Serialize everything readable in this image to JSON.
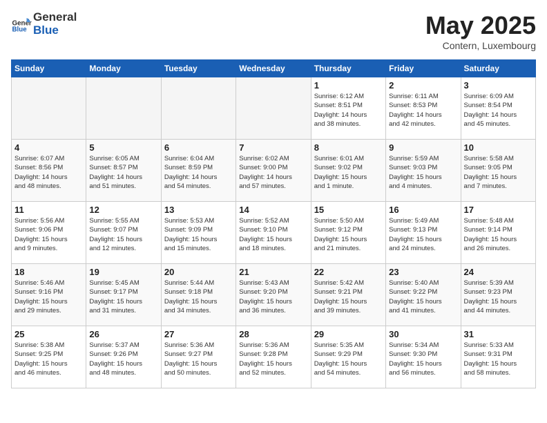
{
  "header": {
    "logo_general": "General",
    "logo_blue": "Blue",
    "month": "May 2025",
    "location": "Contern, Luxembourg"
  },
  "weekdays": [
    "Sunday",
    "Monday",
    "Tuesday",
    "Wednesday",
    "Thursday",
    "Friday",
    "Saturday"
  ],
  "weeks": [
    [
      {
        "day": "",
        "info": ""
      },
      {
        "day": "",
        "info": ""
      },
      {
        "day": "",
        "info": ""
      },
      {
        "day": "",
        "info": ""
      },
      {
        "day": "1",
        "info": "Sunrise: 6:12 AM\nSunset: 8:51 PM\nDaylight: 14 hours\nand 38 minutes."
      },
      {
        "day": "2",
        "info": "Sunrise: 6:11 AM\nSunset: 8:53 PM\nDaylight: 14 hours\nand 42 minutes."
      },
      {
        "day": "3",
        "info": "Sunrise: 6:09 AM\nSunset: 8:54 PM\nDaylight: 14 hours\nand 45 minutes."
      }
    ],
    [
      {
        "day": "4",
        "info": "Sunrise: 6:07 AM\nSunset: 8:56 PM\nDaylight: 14 hours\nand 48 minutes."
      },
      {
        "day": "5",
        "info": "Sunrise: 6:05 AM\nSunset: 8:57 PM\nDaylight: 14 hours\nand 51 minutes."
      },
      {
        "day": "6",
        "info": "Sunrise: 6:04 AM\nSunset: 8:59 PM\nDaylight: 14 hours\nand 54 minutes."
      },
      {
        "day": "7",
        "info": "Sunrise: 6:02 AM\nSunset: 9:00 PM\nDaylight: 14 hours\nand 57 minutes."
      },
      {
        "day": "8",
        "info": "Sunrise: 6:01 AM\nSunset: 9:02 PM\nDaylight: 15 hours\nand 1 minute."
      },
      {
        "day": "9",
        "info": "Sunrise: 5:59 AM\nSunset: 9:03 PM\nDaylight: 15 hours\nand 4 minutes."
      },
      {
        "day": "10",
        "info": "Sunrise: 5:58 AM\nSunset: 9:05 PM\nDaylight: 15 hours\nand 7 minutes."
      }
    ],
    [
      {
        "day": "11",
        "info": "Sunrise: 5:56 AM\nSunset: 9:06 PM\nDaylight: 15 hours\nand 9 minutes."
      },
      {
        "day": "12",
        "info": "Sunrise: 5:55 AM\nSunset: 9:07 PM\nDaylight: 15 hours\nand 12 minutes."
      },
      {
        "day": "13",
        "info": "Sunrise: 5:53 AM\nSunset: 9:09 PM\nDaylight: 15 hours\nand 15 minutes."
      },
      {
        "day": "14",
        "info": "Sunrise: 5:52 AM\nSunset: 9:10 PM\nDaylight: 15 hours\nand 18 minutes."
      },
      {
        "day": "15",
        "info": "Sunrise: 5:50 AM\nSunset: 9:12 PM\nDaylight: 15 hours\nand 21 minutes."
      },
      {
        "day": "16",
        "info": "Sunrise: 5:49 AM\nSunset: 9:13 PM\nDaylight: 15 hours\nand 24 minutes."
      },
      {
        "day": "17",
        "info": "Sunrise: 5:48 AM\nSunset: 9:14 PM\nDaylight: 15 hours\nand 26 minutes."
      }
    ],
    [
      {
        "day": "18",
        "info": "Sunrise: 5:46 AM\nSunset: 9:16 PM\nDaylight: 15 hours\nand 29 minutes."
      },
      {
        "day": "19",
        "info": "Sunrise: 5:45 AM\nSunset: 9:17 PM\nDaylight: 15 hours\nand 31 minutes."
      },
      {
        "day": "20",
        "info": "Sunrise: 5:44 AM\nSunset: 9:18 PM\nDaylight: 15 hours\nand 34 minutes."
      },
      {
        "day": "21",
        "info": "Sunrise: 5:43 AM\nSunset: 9:20 PM\nDaylight: 15 hours\nand 36 minutes."
      },
      {
        "day": "22",
        "info": "Sunrise: 5:42 AM\nSunset: 9:21 PM\nDaylight: 15 hours\nand 39 minutes."
      },
      {
        "day": "23",
        "info": "Sunrise: 5:40 AM\nSunset: 9:22 PM\nDaylight: 15 hours\nand 41 minutes."
      },
      {
        "day": "24",
        "info": "Sunrise: 5:39 AM\nSunset: 9:23 PM\nDaylight: 15 hours\nand 44 minutes."
      }
    ],
    [
      {
        "day": "25",
        "info": "Sunrise: 5:38 AM\nSunset: 9:25 PM\nDaylight: 15 hours\nand 46 minutes."
      },
      {
        "day": "26",
        "info": "Sunrise: 5:37 AM\nSunset: 9:26 PM\nDaylight: 15 hours\nand 48 minutes."
      },
      {
        "day": "27",
        "info": "Sunrise: 5:36 AM\nSunset: 9:27 PM\nDaylight: 15 hours\nand 50 minutes."
      },
      {
        "day": "28",
        "info": "Sunrise: 5:36 AM\nSunset: 9:28 PM\nDaylight: 15 hours\nand 52 minutes."
      },
      {
        "day": "29",
        "info": "Sunrise: 5:35 AM\nSunset: 9:29 PM\nDaylight: 15 hours\nand 54 minutes."
      },
      {
        "day": "30",
        "info": "Sunrise: 5:34 AM\nSunset: 9:30 PM\nDaylight: 15 hours\nand 56 minutes."
      },
      {
        "day": "31",
        "info": "Sunrise: 5:33 AM\nSunset: 9:31 PM\nDaylight: 15 hours\nand 58 minutes."
      }
    ]
  ]
}
